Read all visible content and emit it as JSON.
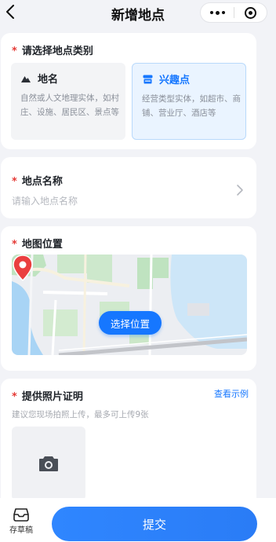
{
  "header": {
    "title": "新增地点",
    "back_icon": "chevron-left-icon",
    "more_icon": "more-dots-icon",
    "close_icon": "target-close-icon"
  },
  "category": {
    "required_mark": "*",
    "title": "请选择地点类别",
    "options": [
      {
        "label": "地名",
        "icon": "mountain-icon",
        "description": "自然或人文地理实体，如村庄、设施、居民区、景点等",
        "selected": false
      },
      {
        "label": "兴趣点",
        "icon": "storefront-icon",
        "description": "经营类型实体，如超市、商铺、营业厅、酒店等",
        "selected": true
      }
    ]
  },
  "place_name": {
    "required_mark": "*",
    "title": "地点名称",
    "placeholder": "请输入地点名称"
  },
  "map": {
    "required_mark": "*",
    "title": "地图位置",
    "button_label": "选择位置",
    "pin_icon": "location-pin-icon"
  },
  "photo": {
    "required_mark": "*",
    "title": "提供照片证明",
    "example_link": "查看示例",
    "hint": "建议您现场拍照上传，最多可上传9张",
    "upload_icon": "camera-icon"
  },
  "bottom": {
    "draft_label": "存草稿",
    "draft_icon": "inbox-tray-icon",
    "submit_label": "提交"
  },
  "colors": {
    "accent": "#1677ff",
    "required": "#e53935",
    "background": "#f2f3f7"
  }
}
